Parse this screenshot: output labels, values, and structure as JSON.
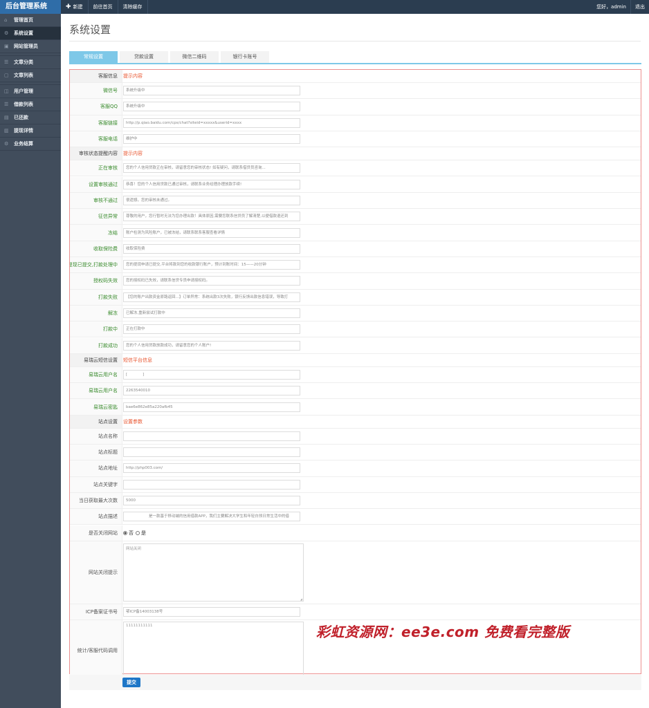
{
  "app": {
    "logo": "后台管理系统"
  },
  "topnav": [
    {
      "label": "新建",
      "icon": "plus-icon"
    },
    {
      "label": "前往首页"
    },
    {
      "label": "清除缓存"
    }
  ],
  "topright": {
    "greeting": "您好，admin",
    "logout": "退出"
  },
  "sidebar": [
    {
      "label": "管理首页",
      "icon": "home-icon"
    },
    {
      "label": "系统设置",
      "icon": "gear-icon",
      "active": true
    },
    {
      "label": "网站管理员",
      "icon": "user-icon"
    },
    {
      "label": "文章分类",
      "icon": "list-icon"
    },
    {
      "label": "文章列表",
      "icon": "document-icon"
    },
    {
      "label": "用户管理",
      "icon": "users-icon"
    },
    {
      "label": "借款列表",
      "icon": "list-icon"
    },
    {
      "label": "已还款",
      "icon": "check-icon"
    },
    {
      "label": "提现详情",
      "icon": "wallet-icon"
    },
    {
      "label": "业务结算",
      "icon": "gear-icon"
    }
  ],
  "page": {
    "title": "系统设置"
  },
  "tabs": [
    "常规设置",
    "贷款设置",
    "微信二维码",
    "银行卡账号"
  ],
  "rows": [
    {
      "type": "section",
      "label": "客服信息",
      "value": "提示内容"
    },
    {
      "label": "微信号",
      "value": "系统升级中"
    },
    {
      "label": "客服QQ",
      "value": "系统升级中"
    },
    {
      "label": "客服链接",
      "value": "http://p.qiao.baidu.com/cps/chat?siteid=xxxxx&userid=xxxx"
    },
    {
      "label": "客服电话",
      "value": "维护中"
    },
    {
      "type": "section",
      "label": "审核状态提醒内容",
      "value": "提示内容"
    },
    {
      "label": "正在审核",
      "value": "您的个人信用贷款正在审核，请留意您的审核状态! 如有疑问，请联系借贷员咨询..."
    },
    {
      "label": "设置审核通过",
      "value": "恭喜！您的个人信用贷款已通过审核，请联系业务经理办理放款手续!"
    },
    {
      "label": "审核不通过",
      "value": "很遗憾，您的审核未通过。"
    },
    {
      "label": "征信异常",
      "value": "尊敬的用户，您行暂时无法为您办理出款！具体原因,需要您联系信贷员了解清楚,以便借款退还到"
    },
    {
      "label": "冻结",
      "value": "账户检测为风险账户，已被冻结，请联系联系客服查看详情"
    },
    {
      "label": "收取保险费",
      "value": "收取保险费"
    },
    {
      "label": "提现已提交,打款处理中",
      "value": "您的提现申请已提交,平台将款到您的收款银行账户，预计到账时间：15——20分钟"
    },
    {
      "label": "授权码失效",
      "value": "您的授权码已失效，请联系信贷专员申请授权码。"
    },
    {
      "label": "打款失败",
      "value": "【您的账户出款资金原路返回...】订单异常：系统出款3次失败，银行反馈出款信息错误，导致打"
    },
    {
      "label": "解冻",
      "value": "已解冻,重新尝试打款中"
    },
    {
      "label": "打款中",
      "value": "正在打款中"
    },
    {
      "label": "打款成功",
      "value": "您的个人信用贷款放款成功，请留意您的个人账户!"
    },
    {
      "type": "section",
      "label": "易瑞云短信设置",
      "value": "短信平台信息"
    },
    {
      "label": "易瑞云用户名",
      "value": "[　　　　]"
    },
    {
      "label": "易瑞云用户名",
      "value": "2263540010"
    },
    {
      "label": "易瑞云密匙",
      "value": "bae6e862e85a220afb45"
    },
    {
      "type": "section",
      "label": "站点设置",
      "value": "设置参数"
    },
    {
      "type": "plain",
      "label": "站点名称",
      "value": ""
    },
    {
      "type": "plain",
      "label": "站点标题",
      "value": ""
    },
    {
      "type": "plain",
      "label": "站点地址",
      "value": "http://php003.com/"
    },
    {
      "type": "plain",
      "label": "站点关键字",
      "value": ""
    },
    {
      "type": "plain",
      "label": "当日获取最大次数",
      "value": "5000"
    },
    {
      "type": "plain",
      "label": "站点描述",
      "value": "　　　　　　是一款基于移动端的信用借款APP，我们主要解决大学生和年轻白领日常生活中的借"
    },
    {
      "type": "radio",
      "label": "是否关闭网站",
      "options": [
        "否",
        "是"
      ],
      "selected": 0
    },
    {
      "type": "textarea",
      "label": "网站关闭提示",
      "value": "网站关闭"
    },
    {
      "type": "plain",
      "label": "ICP备案证书号",
      "value": "鄂ICP备14003138号"
    },
    {
      "type": "textarea",
      "label": "统计/客服代码调用",
      "value": "11111111111"
    }
  ],
  "submit": {
    "label": "提交"
  },
  "watermark": "彩虹资源网：ee3e.com 免费看完整版"
}
